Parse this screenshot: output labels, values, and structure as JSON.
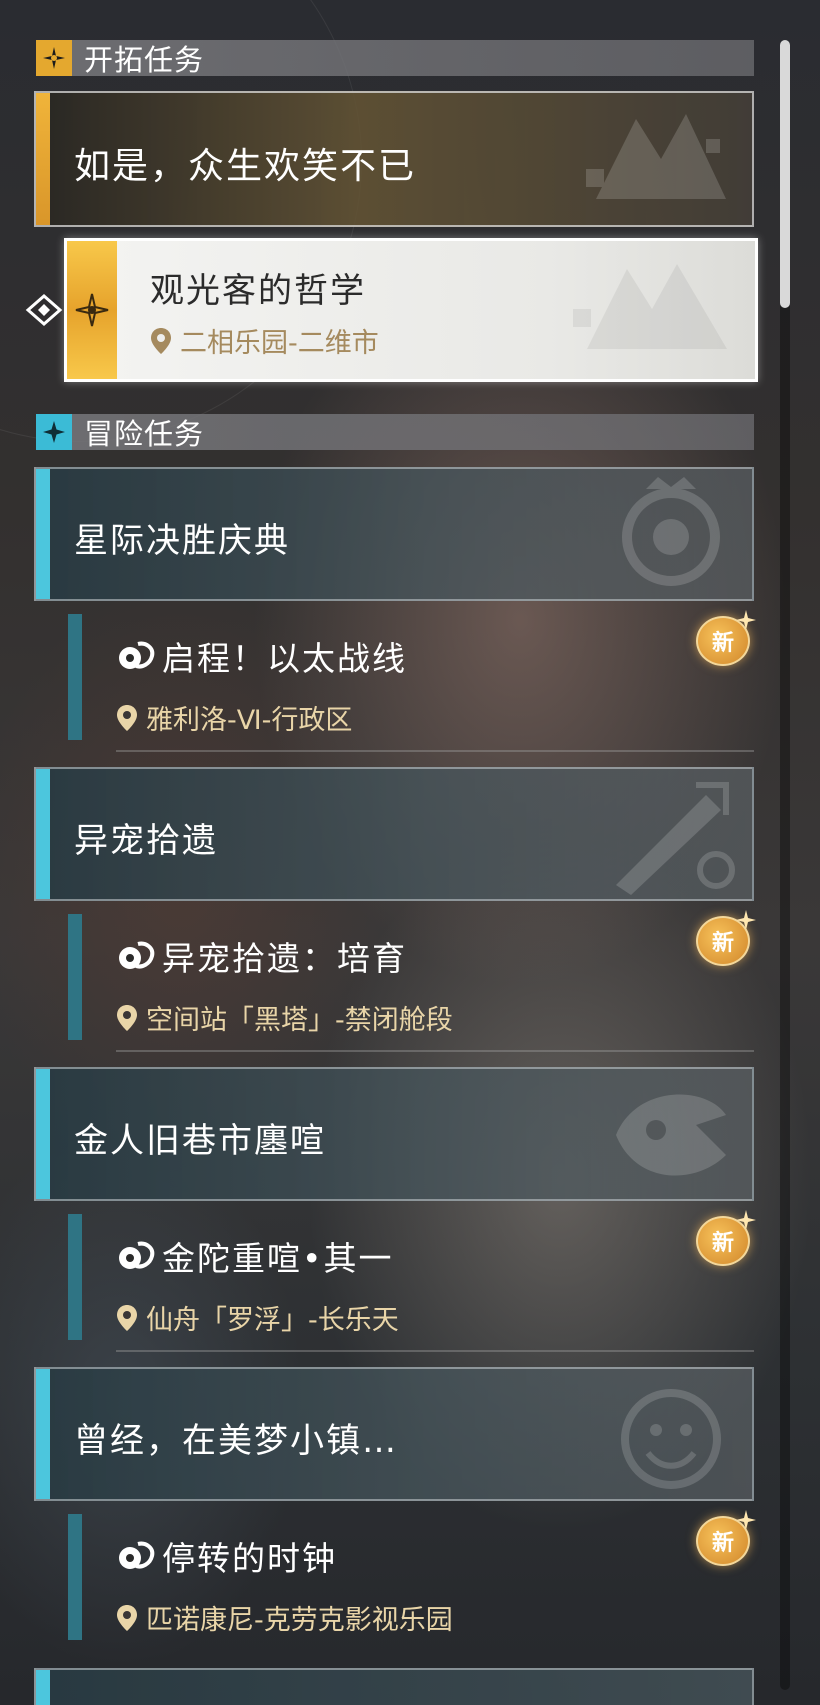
{
  "sections": {
    "trailblaze": {
      "title": "开拓任务",
      "icon": "trailblaze-emblem-icon",
      "color": "#e4a82f"
    },
    "adventure": {
      "title": "冒险任务",
      "icon": "compass-star-icon",
      "color": "#3bbbd6"
    }
  },
  "main_quest": {
    "title": "如是，众生欢笑不已",
    "sub": {
      "title": "观光客的哲学",
      "location": "二相乐园-二维市"
    }
  },
  "adventure_quests": [
    {
      "title": "星际决胜庆典",
      "sub": {
        "title": "启程！以太战线",
        "location": "雅利洛-Ⅵ-行政区",
        "badge": "新"
      }
    },
    {
      "title": "异宠拾遗",
      "sub": {
        "title": "异宠拾遗：培育",
        "location": "空间站「黑塔」-禁闭舱段",
        "badge": "新"
      }
    },
    {
      "title": "金人旧巷市廛喧",
      "sub": {
        "title": "金陀重喧•其一",
        "location": "仙舟「罗浮」-长乐天",
        "badge": "新"
      }
    },
    {
      "title": "曾经，在美梦小镇…",
      "sub": {
        "title": "停转的时钟",
        "location": "匹诺康尼-克劳克影视乐园",
        "badge": "新"
      }
    }
  ],
  "colors": {
    "accent_gold": "#e4a82f",
    "accent_cyan": "#4cc6dd",
    "location_text": "#e9d5a8"
  }
}
